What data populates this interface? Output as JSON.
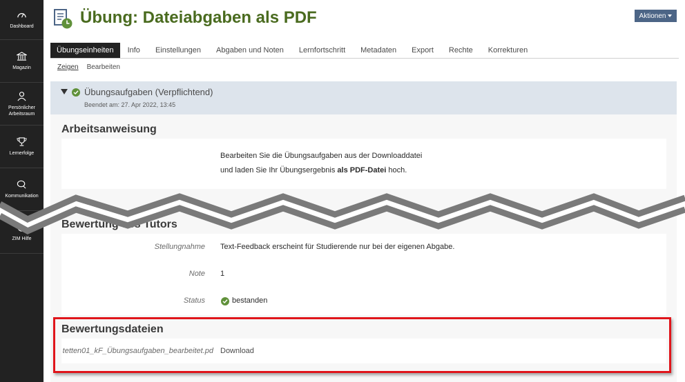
{
  "sidebar": {
    "items": [
      {
        "label": "Dashboard",
        "icon": "dashboard-icon"
      },
      {
        "label": "Magazin",
        "icon": "library-icon"
      },
      {
        "label": "Persönlicher Arbeitsraum",
        "icon": "user-icon"
      },
      {
        "label": "Lernerfolge",
        "icon": "trophy-icon"
      },
      {
        "label": "Kommunikation",
        "icon": "chat-icon"
      },
      {
        "label": "ZIM Hilfe",
        "icon": "help-icon"
      }
    ]
  },
  "header": {
    "title": "Übung: Dateiabgaben als PDF",
    "actions_label": "Aktionen"
  },
  "tabs": [
    {
      "label": "Übungseinheiten",
      "active": true
    },
    {
      "label": "Info"
    },
    {
      "label": "Einstellungen"
    },
    {
      "label": "Abgaben und Noten"
    },
    {
      "label": "Lernfortschritt"
    },
    {
      "label": "Metadaten"
    },
    {
      "label": "Export"
    },
    {
      "label": "Rechte"
    },
    {
      "label": "Korrekturen"
    }
  ],
  "subtabs": [
    {
      "label": "Zeigen",
      "active": true
    },
    {
      "label": "Bearbeiten"
    }
  ],
  "assignment": {
    "title": "Übungsaufgaben (Verpflichtend)",
    "ended": "Beendet am: 27. Apr 2022, 13:45"
  },
  "instructions": {
    "title": "Arbeitsanweisung",
    "line1": "Bearbeiten Sie die Übungsaufgaben aus der Downloaddatei",
    "line2_prefix": "und laden Sie Ihr Übungsergebnis ",
    "line2_bold": "als PDF-Datei",
    "line2_suffix": " hoch."
  },
  "tutor": {
    "title": "Bewertung des Tutors",
    "statement_label": "Stellungnahme",
    "statement_value": "Text-Feedback erscheint für Studierende nur bei der eigenen Abgabe.",
    "grade_label": "Note",
    "grade_value": "1",
    "status_label": "Status",
    "status_value": "bestanden"
  },
  "files": {
    "title": "Bewertungsdateien",
    "filename": "tetten01_kF_Übungsaufgaben_bearbeitet.pd",
    "download_label": "Download"
  },
  "colors": {
    "sidebar": "#222222",
    "title": "#4a6b1f",
    "actions": "#4c6586",
    "panel_head": "#dde4ec",
    "success": "#60913a",
    "highlight": "#e0151b"
  }
}
